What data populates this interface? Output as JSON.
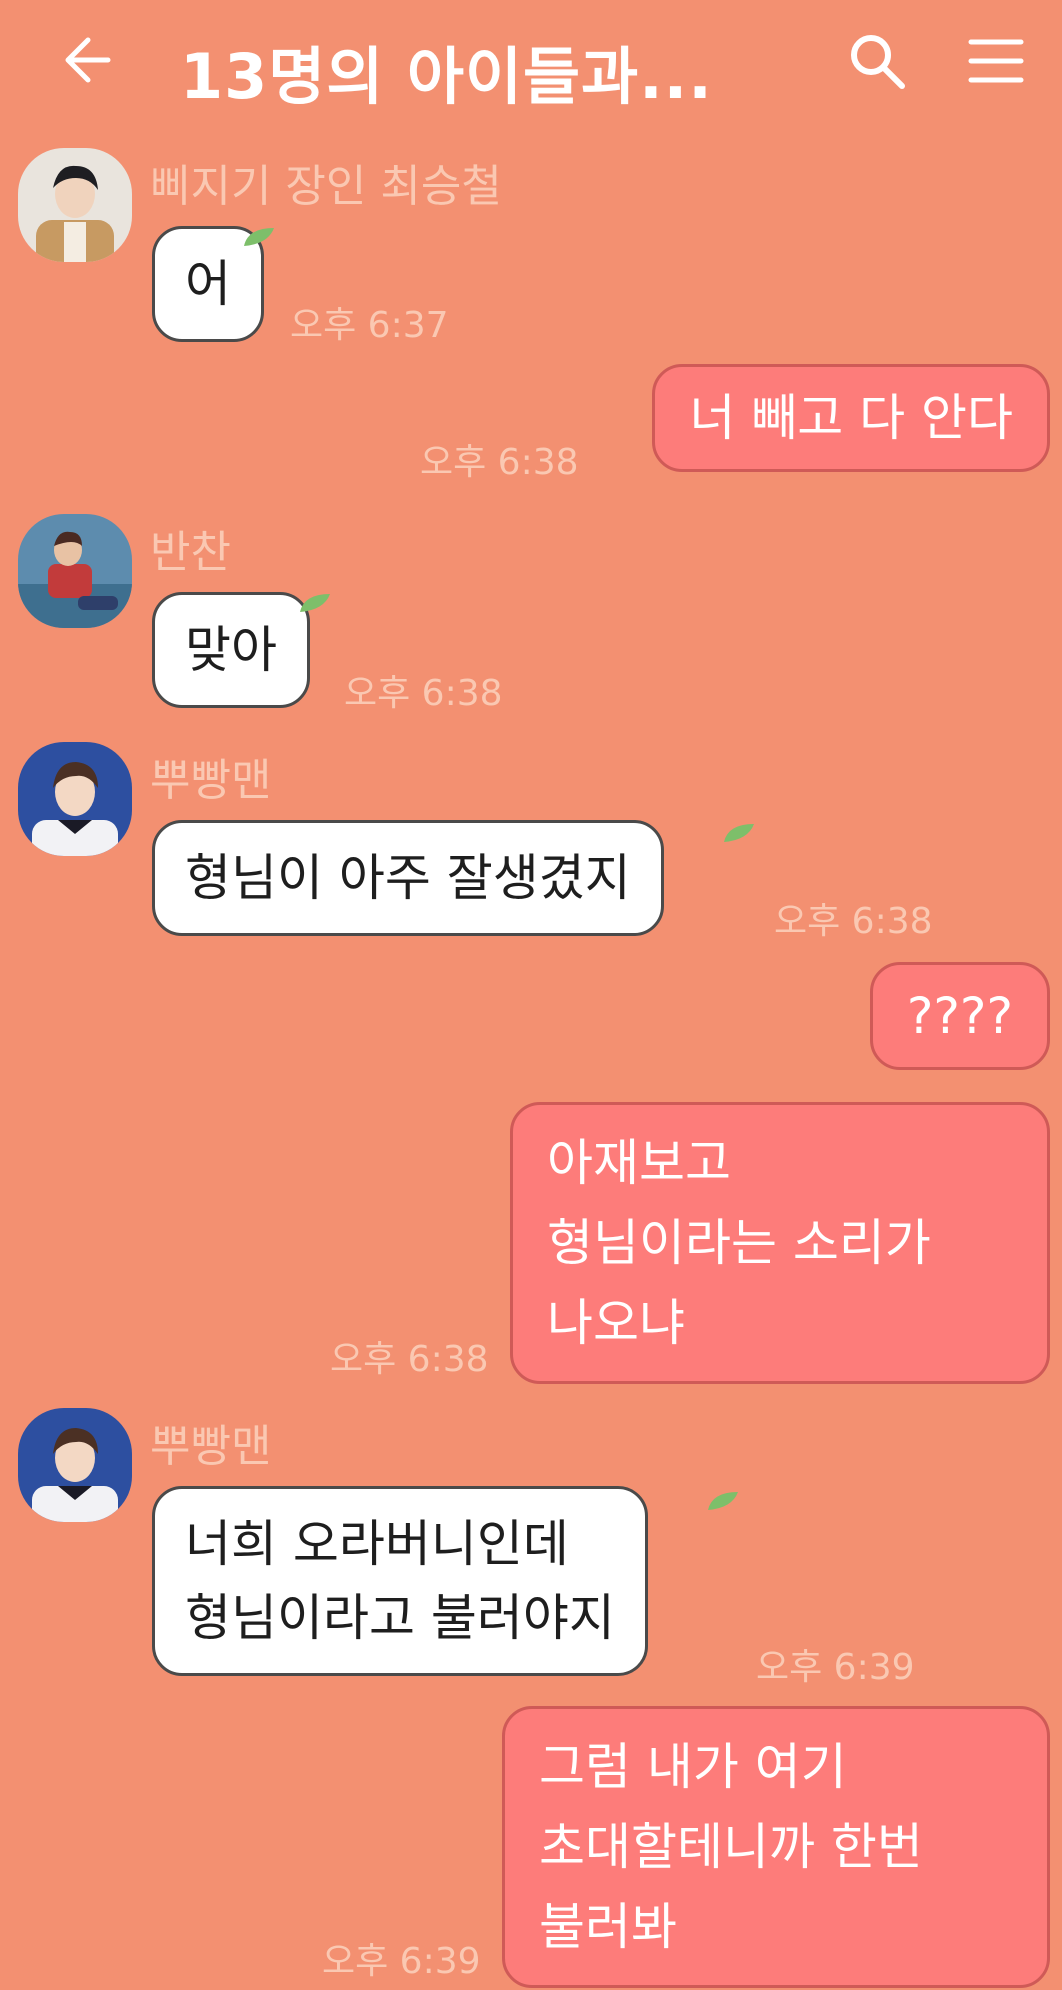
{
  "header": {
    "title": "13명의 아이들과...",
    "back_icon": "arrow-left-icon",
    "search_icon": "search-icon",
    "menu_icon": "hamburger-menu-icon"
  },
  "colors": {
    "background": "#F39071",
    "incoming_bubble": "#FFFFFF",
    "outgoing_bubble": "#FD7C7A",
    "meta_text": "#FAC8B2",
    "leaf_accent": "#7DBF6A"
  },
  "messages": [
    {
      "direction": "in",
      "sender": "삐지기 장인 최승철",
      "lines": [
        "어"
      ],
      "time": "오후 6:37"
    },
    {
      "direction": "out",
      "lines": [
        "너 빼고 다 안다"
      ],
      "time": "오후 6:38"
    },
    {
      "direction": "in",
      "sender": "반찬",
      "lines": [
        "맞아"
      ],
      "time": "오후 6:38"
    },
    {
      "direction": "in",
      "sender": "뿌빵맨",
      "lines": [
        "형님이 아주 잘생겼지"
      ],
      "time": "오후 6:38"
    },
    {
      "direction": "out",
      "lines": [
        "????"
      ],
      "time": ""
    },
    {
      "direction": "out",
      "lines": [
        "아재보고",
        "형님이라는 소리가",
        "나오냐"
      ],
      "time": "오후 6:38"
    },
    {
      "direction": "in",
      "sender": "뿌빵맨",
      "lines": [
        "너희 오라버니인데",
        "형님이라고 불러야지"
      ],
      "time": "오후 6:39"
    },
    {
      "direction": "out",
      "lines": [
        "그럼 내가 여기",
        "초대할테니까 한번",
        "불러봐"
      ],
      "time": "오후 6:39"
    }
  ]
}
